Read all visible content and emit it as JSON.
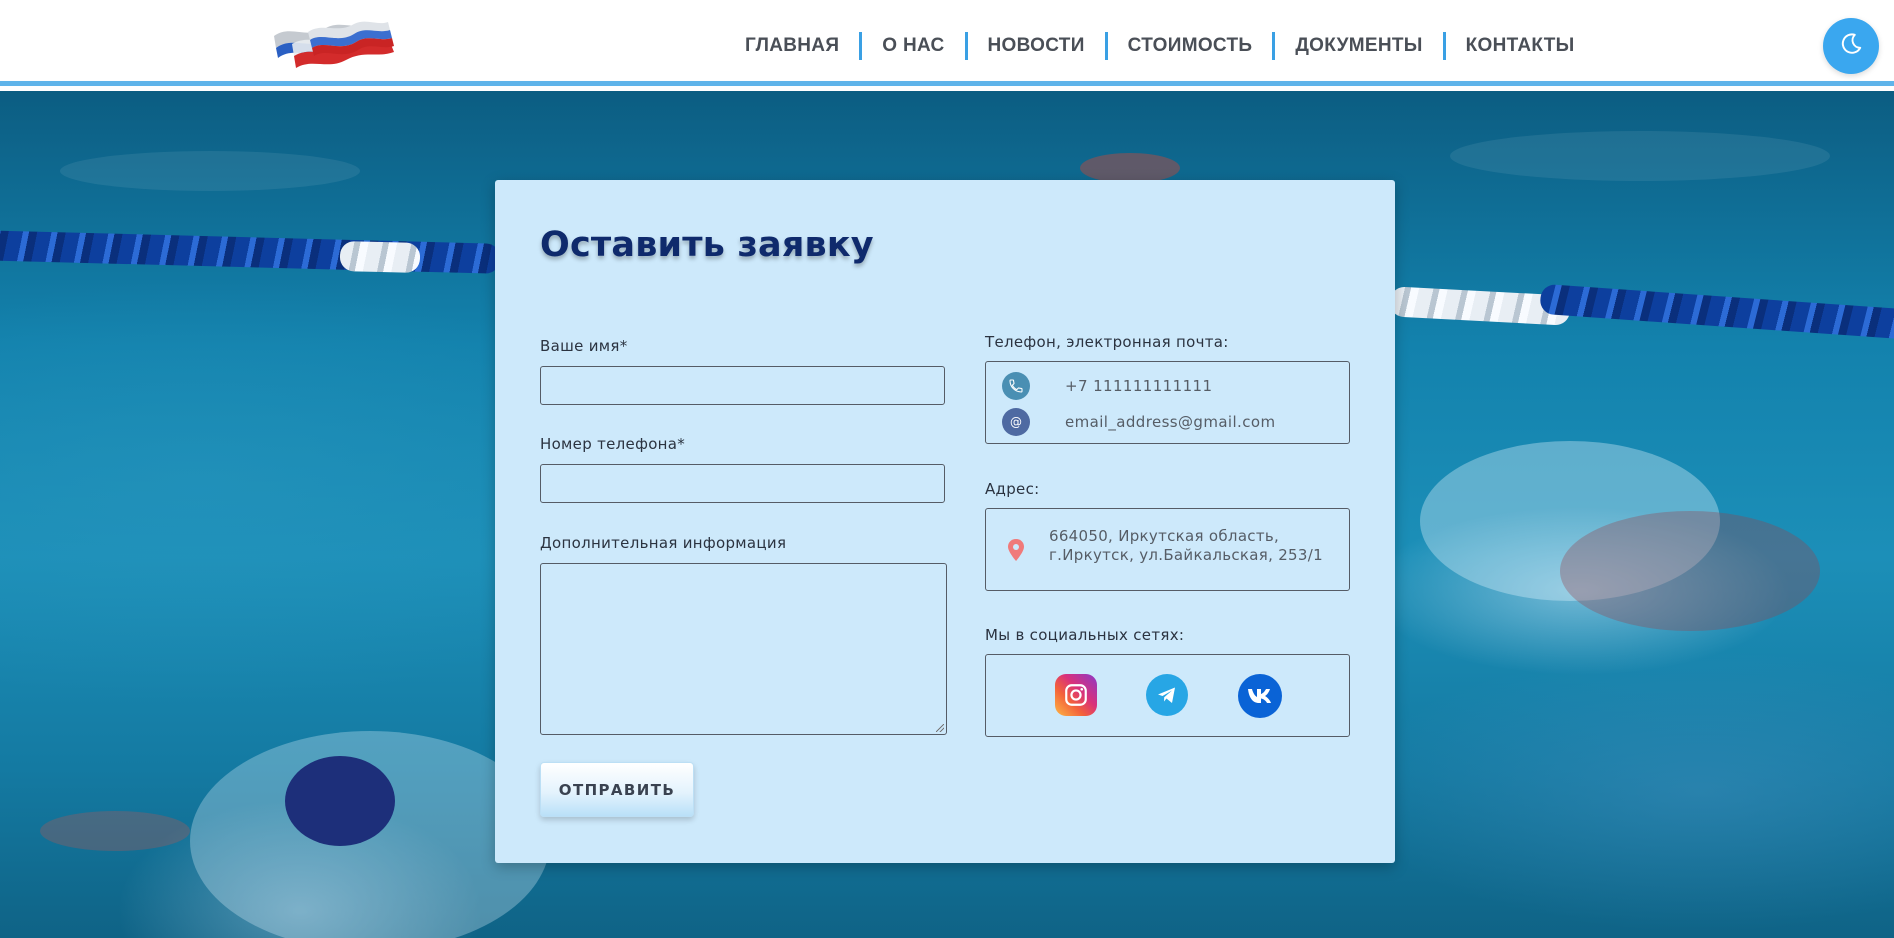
{
  "nav": {
    "items": [
      {
        "label": "ГЛАВНАЯ"
      },
      {
        "label": "О НАС"
      },
      {
        "label": "НОВОСТИ"
      },
      {
        "label": "СТОИМОСТЬ"
      },
      {
        "label": "ДОКУМЕНТЫ"
      },
      {
        "label": "КОНТАКТЫ"
      }
    ],
    "theme_toggle_icon": "moon-icon"
  },
  "logo": {
    "icon": "flag-logo-icon",
    "colors": [
      "#c4c9cf",
      "#2a5fc3",
      "#d32b2b"
    ]
  },
  "form": {
    "title": "Оставить заявку",
    "name_label": "Ваше имя*",
    "name_value": "",
    "phone_label": "Номер телефона*",
    "phone_value": "",
    "info_label": "Дополнительная информация",
    "info_value": "",
    "submit_label": "ОТПРАВИТЬ"
  },
  "contacts": {
    "contact_label": "Телефон, электронная почта:",
    "phone": "+7 111111111111",
    "email": "email_address@gmail.com",
    "address_label": "Адрес:",
    "address_line1": "664050, Иркутская область,",
    "address_line2": "г.Иркутск, ул.Байкальская, 253/1",
    "social_label": "Мы в социальных сетях:",
    "social": [
      {
        "name": "instagram-icon"
      },
      {
        "name": "telegram-icon"
      },
      {
        "name": "vk-icon"
      }
    ]
  },
  "colors": {
    "accent": "#3aa7ef",
    "title": "#0f2a6c",
    "card_bg": "#cde9fb"
  }
}
